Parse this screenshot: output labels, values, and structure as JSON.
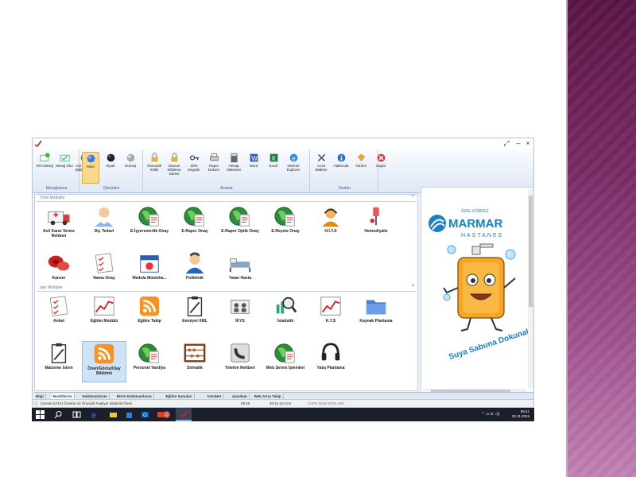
{
  "window": {
    "controls": [
      "⤢",
      "–",
      "×"
    ]
  },
  "ribbon": {
    "groups": [
      {
        "label": "Mesajlasma",
        "buttons": [
          {
            "label": "Yeni Mesaj",
            "icon": "new-message-icon"
          },
          {
            "label": "Mesaj Oku",
            "icon": "read-message-icon"
          },
          {
            "label": "Acil Durum Bildirimi Aç",
            "icon": "emergency-notify-icon"
          }
        ]
      },
      {
        "label": "Görünüm",
        "buttons": [
          {
            "label": "Mavi",
            "icon": "blue-theme-icon",
            "selected": true
          },
          {
            "label": "Siyah",
            "icon": "black-theme-icon"
          },
          {
            "label": "Gümüş",
            "icon": "silver-theme-icon"
          }
        ]
      },
      {
        "label": "Araclar",
        "buttons": [
          {
            "label": "Otomatik Kilitle",
            "icon": "auto-lock-icon"
          },
          {
            "label": "Oturum Kilitleme Süresi",
            "icon": "lock-timeout-icon"
          },
          {
            "label": "Sifre Degistir",
            "icon": "change-password-icon"
          },
          {
            "label": "Rapor Dokum",
            "icon": "report-print-icon"
          },
          {
            "label": "Hesap Makinesi",
            "icon": "calculator-icon"
          },
          {
            "label": "Word",
            "icon": "word-icon"
          },
          {
            "label": "Excel",
            "icon": "excel-icon"
          },
          {
            "label": "Internet Explorer",
            "icon": "internet-explorer-icon"
          }
        ]
      },
      {
        "label": "Yardim",
        "buttons": [
          {
            "label": "Arıza Bildirim",
            "icon": "fault-report-icon"
          },
          {
            "label": "Hakkında",
            "icon": "about-icon"
          },
          {
            "label": "Yardım",
            "icon": "help-icon"
          },
          {
            "label": "Kapat",
            "icon": "close-app-icon"
          }
        ]
      }
    ]
  },
  "sections": [
    {
      "title": "Tıbbi Modüller",
      "collapse": "^",
      "items": [
        {
          "label": "Acil Karar Verme Rehberi",
          "icon": "ambulance-icon"
        },
        {
          "label": "Diş Tedavi",
          "icon": "tooth-doctor-icon"
        },
        {
          "label": "E-İşyeremerlik Onay",
          "icon": "globe-document-icon"
        },
        {
          "label": "E-Rapor Onay",
          "icon": "globe-document-icon"
        },
        {
          "label": "E-Rapor Optik Onay",
          "icon": "globe-document-icon"
        },
        {
          "label": "E-Reçete Onay",
          "icon": "globe-document-icon"
        },
        {
          "label": "H.İ.Y.S",
          "icon": "headset-user-icon"
        },
        {
          "label": "Hemodiyaliz",
          "icon": "hemodialysis-icon"
        },
        {
          "label": "Kanser",
          "icon": "cells-icon"
        },
        {
          "label": "Nama Onay",
          "icon": "checklist-icon"
        },
        {
          "label": "Medula Müsteha...",
          "icon": "medula-icon"
        },
        {
          "label": "Poliklinik",
          "icon": "doctor-icon"
        },
        {
          "label": "Yatan Hasta",
          "icon": "bed-icon"
        }
      ]
    },
    {
      "title": "dari Modüller",
      "collapse": "^",
      "items": [
        {
          "label": "Anket",
          "icon": "checklist-icon"
        },
        {
          "label": "Eğitim Modülü",
          "icon": "line-chart-icon"
        },
        {
          "label": "Eğitim Takip",
          "icon": "rss-icon"
        },
        {
          "label": "Emniyet XML",
          "icon": "clipboard-icon"
        },
        {
          "label": "İKYS",
          "icon": "people-icon"
        },
        {
          "label": "İstatistik",
          "icon": "magnifier-chart-icon"
        },
        {
          "label": "K.Y.S",
          "icon": "line-chart-icon"
        },
        {
          "label": "Kaynak Planlama",
          "icon": "folder-icon"
        },
        {
          "label": "Malzeme İstem",
          "icon": "clipboard-icon"
        },
        {
          "label": "Öneri/Görüş/Olay Bildirimi",
          "icon": "rss-icon",
          "selected": true
        },
        {
          "label": "Personel Vardiya",
          "icon": "globe-document-icon"
        },
        {
          "label": "Sirmatik",
          "icon": "abacus-icon"
        },
        {
          "label": "Telefon Rehberi",
          "icon": "phone-icon"
        },
        {
          "label": "Web Servis İşlemleri",
          "icon": "globe-document-icon"
        },
        {
          "label": "Yatış Planlama",
          "icon": "headset-icon"
        }
      ]
    }
  ],
  "sidebar": {
    "logo": {
      "top": "ÖZEL KÖRFEZ",
      "name": "MARMAR",
      "sub": "HASTANES"
    },
    "mascot_text": "Suya Sabuna Dokunalım"
  },
  "tabs": [
    {
      "label": "Bilgi"
    },
    {
      "label": "Modüllerim",
      "active": true
    },
    {
      "label": "Dokümanlarım"
    },
    {
      "label": "Birim Dokümanlarım"
    },
    {
      "label": "Eğitim Sunuları"
    },
    {
      "label": "IntraNet"
    },
    {
      "label": "Ajandam"
    },
    {
      "label": "Web Arıza Takip"
    }
  ],
  "statusbar": {
    "left": "(Gerek DATA) Ölceklü Ve Ömeyild Faaliyet İstatistik Öneri",
    "time": "08:46",
    "date": "30-11-15 Crm",
    "keys": "CAPS  NUM  SCRL  INS"
  },
  "taskbar": {
    "time": "08:41",
    "date": "30.11.2015",
    "tray": "⌃ ▭ ⊏ ◁)"
  },
  "colors": {
    "accent": "#1a4f9e",
    "slide": "#7a2a64",
    "ribbon": "#dfe8f5"
  }
}
